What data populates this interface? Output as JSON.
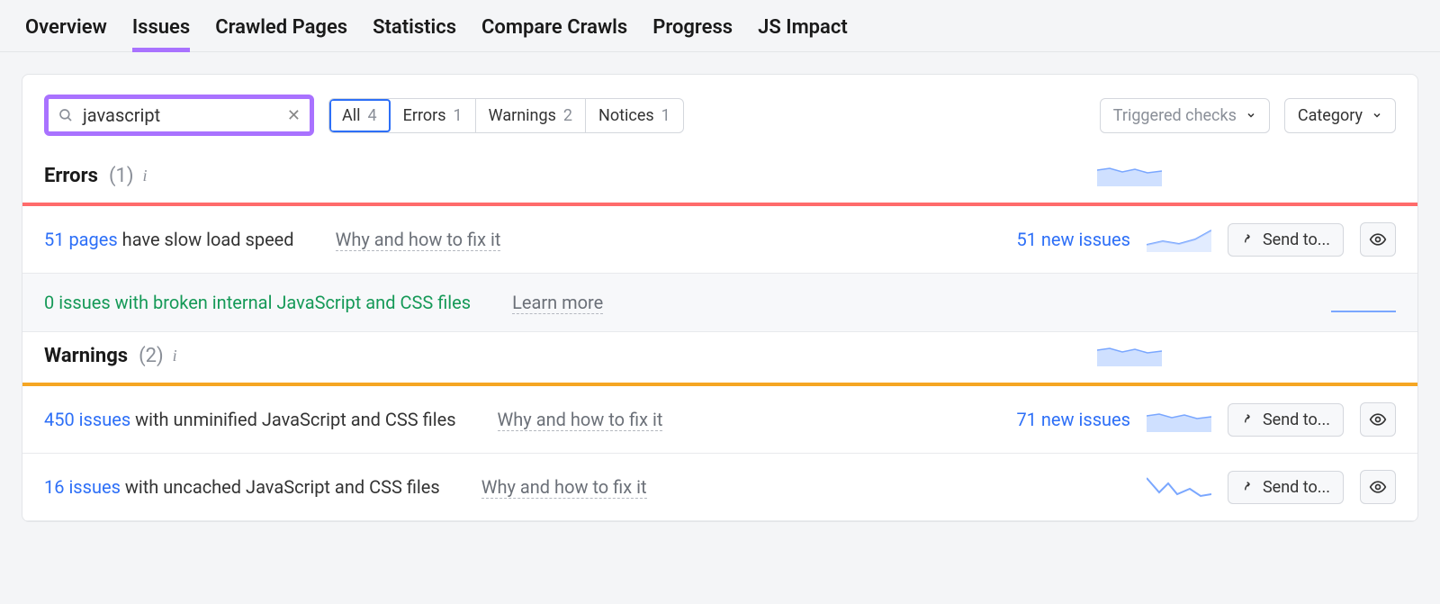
{
  "nav": {
    "tabs": [
      "Overview",
      "Issues",
      "Crawled Pages",
      "Statistics",
      "Compare Crawls",
      "Progress",
      "JS Impact"
    ],
    "active": "Issues"
  },
  "search": {
    "value": "javascript"
  },
  "filters": {
    "segments": [
      {
        "label": "All",
        "count": "4",
        "active": true
      },
      {
        "label": "Errors",
        "count": "1",
        "active": false
      },
      {
        "label": "Warnings",
        "count": "2",
        "active": false
      },
      {
        "label": "Notices",
        "count": "1",
        "active": false
      }
    ],
    "triggered_label": "Triggered checks",
    "category_label": "Category"
  },
  "sections": [
    {
      "title": "Errors",
      "count": "(1)",
      "divider": "red",
      "rows": [
        {
          "link_text": "51 pages",
          "rest": " have slow load speed",
          "why": "Why and how to fix it",
          "new_issues": "51 new issues",
          "spark": "line-up",
          "actions": true
        },
        {
          "green_text": "0 issues with broken internal JavaScript and CSS files",
          "why": "Learn more",
          "spark": "flat",
          "muted": true,
          "actions": false
        }
      ]
    },
    {
      "title": "Warnings",
      "count": "(2)",
      "divider": "orange",
      "rows": [
        {
          "link_text": "450 issues",
          "rest": " with unminified JavaScript and CSS files",
          "why": "Why and how to fix it",
          "new_issues": "71 new issues",
          "spark": "area-wavy",
          "actions": true
        },
        {
          "link_text": "16 issues",
          "rest": " with uncached JavaScript and CSS files",
          "why": "Why and how to fix it",
          "spark": "line-jag",
          "actions": true
        }
      ]
    }
  ],
  "buttons": {
    "send_to": "Send to..."
  }
}
